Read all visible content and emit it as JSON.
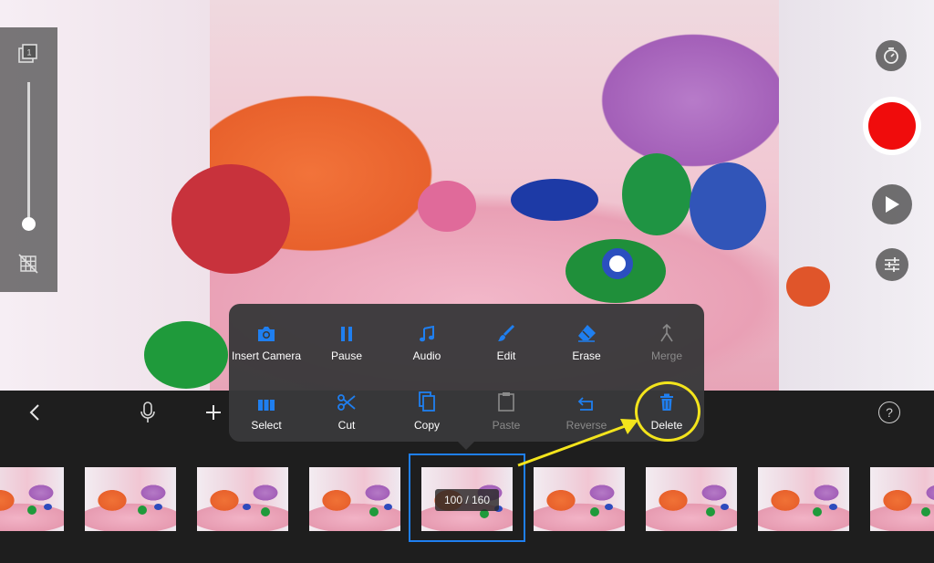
{
  "colors": {
    "accent": "#1f7ff0",
    "record": "#f00c0c",
    "annotation": "#f3e41c",
    "menu_bg": "#38383a",
    "disabled_text": "#8a8a8a"
  },
  "left_panel": {
    "top_icon": "frame-onion-icon",
    "bottom_icon": "grid-off-icon",
    "slider_level": 0.1
  },
  "right_controls": {
    "timer_icon": "timer-icon",
    "record_icon": "record-icon",
    "play_icon": "play-icon",
    "adjust_icon": "sliders-icon"
  },
  "popup_menu": {
    "row1": [
      {
        "label": "Insert Camera",
        "icon": "camera-icon",
        "enabled": true
      },
      {
        "label": "Pause",
        "icon": "pause-icon",
        "enabled": true
      },
      {
        "label": "Audio",
        "icon": "music-note-icon",
        "enabled": true
      },
      {
        "label": "Edit",
        "icon": "brush-icon",
        "enabled": true
      },
      {
        "label": "Erase",
        "icon": "eraser-icon",
        "enabled": true
      },
      {
        "label": "Merge",
        "icon": "merge-icon",
        "enabled": false
      }
    ],
    "row2": [
      {
        "label": "Select",
        "icon": "select-frames-icon",
        "enabled": true
      },
      {
        "label": "Cut",
        "icon": "scissors-icon",
        "enabled": true
      },
      {
        "label": "Copy",
        "icon": "copy-icon",
        "enabled": true
      },
      {
        "label": "Paste",
        "icon": "clipboard-icon",
        "enabled": false
      },
      {
        "label": "Reverse",
        "icon": "reverse-icon",
        "enabled": false
      },
      {
        "label": "Delete",
        "icon": "trash-icon",
        "enabled": true
      }
    ]
  },
  "toolbar": {
    "back_icon": "chevron-left-icon",
    "mic_icon": "microphone-icon",
    "add_icon": "plus-icon",
    "help_label": "?"
  },
  "filmstrip": {
    "frame_counter": "100 / 160",
    "frames_visible": 9
  }
}
